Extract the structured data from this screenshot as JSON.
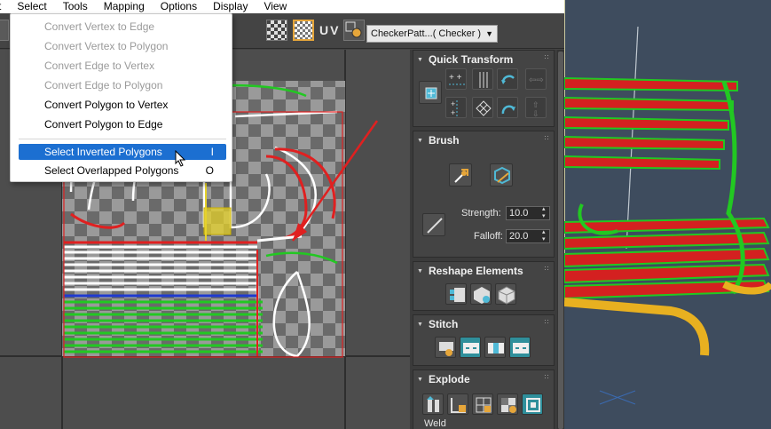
{
  "menubar": {
    "items": [
      "Select",
      "Tools",
      "Mapping",
      "Options",
      "Display",
      "View"
    ]
  },
  "dropdown": {
    "items": [
      {
        "label": "Convert Vertex to Edge",
        "enabled": false,
        "shortcut": ""
      },
      {
        "label": "Convert Vertex to Polygon",
        "enabled": false,
        "shortcut": ""
      },
      {
        "label": "Convert Edge to Vertex",
        "enabled": false,
        "shortcut": ""
      },
      {
        "label": "Convert Edge to Polygon",
        "enabled": false,
        "shortcut": ""
      },
      {
        "label": "Convert Polygon to Vertex",
        "enabled": true,
        "shortcut": ""
      },
      {
        "label": "Convert Polygon to Edge",
        "enabled": true,
        "shortcut": ""
      },
      {
        "label": "Select Inverted Polygons",
        "enabled": true,
        "shortcut": "I",
        "highlighted": true
      },
      {
        "label": "Select Overlapped Polygons",
        "enabled": true,
        "shortcut": "O"
      }
    ]
  },
  "toolbar": {
    "uv_label": "UV",
    "checker_pattern": "CheckerPatt...( Checker )"
  },
  "panels": {
    "quick_transform": {
      "title": "Quick Transform"
    },
    "brush": {
      "title": "Brush",
      "strength_label": "Strength:",
      "strength_value": "10.0",
      "falloff_label": "Falloff:",
      "falloff_value": "20.0"
    },
    "reshape": {
      "title": "Reshape Elements"
    },
    "stitch": {
      "title": "Stitch"
    },
    "explode": {
      "title": "Explode",
      "weld_label": "Weld"
    }
  },
  "colors": {
    "menu_highlight": "#1c6fd1",
    "selection_red": "#e02020",
    "uv_green": "#22c822",
    "active_orange": "#d9a23a",
    "stitch_teal": "#2f8f9b"
  }
}
